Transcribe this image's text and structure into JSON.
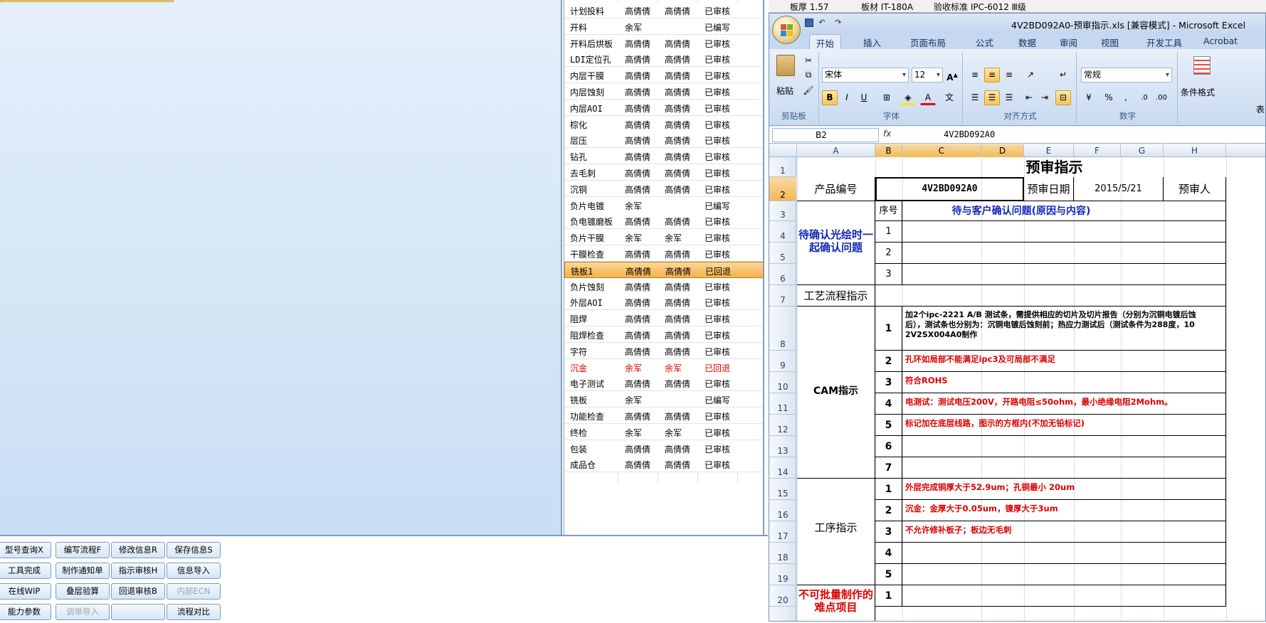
{
  "process_list": {
    "rows": [
      {
        "step": "计划投料",
        "c2": "高倩倩",
        "c3": "高倩倩",
        "status": "已审核"
      },
      {
        "step": "开料",
        "c2": "余军",
        "c3": "",
        "status": "已编写"
      },
      {
        "step": "开料后烘板",
        "c2": "高倩倩",
        "c3": "高倩倩",
        "status": "已审核"
      },
      {
        "step": "LDI定位孔",
        "c2": "高倩倩",
        "c3": "高倩倩",
        "status": "已审核"
      },
      {
        "step": "内层干膜",
        "c2": "高倩倩",
        "c3": "高倩倩",
        "status": "已审核"
      },
      {
        "step": "内层蚀刻",
        "c2": "高倩倩",
        "c3": "高倩倩",
        "status": "已审核"
      },
      {
        "step": "内层AOI",
        "c2": "高倩倩",
        "c3": "高倩倩",
        "status": "已审核"
      },
      {
        "step": "棕化",
        "c2": "高倩倩",
        "c3": "高倩倩",
        "status": "已审核"
      },
      {
        "step": "层压",
        "c2": "高倩倩",
        "c3": "高倩倩",
        "status": "已审核"
      },
      {
        "step": "钻孔",
        "c2": "高倩倩",
        "c3": "高倩倩",
        "status": "已审核"
      },
      {
        "step": "去毛刺",
        "c2": "高倩倩",
        "c3": "高倩倩",
        "status": "已审核"
      },
      {
        "step": "沉铜",
        "c2": "高倩倩",
        "c3": "高倩倩",
        "status": "已审核"
      },
      {
        "step": "负片电镀",
        "c2": "余军",
        "c3": "",
        "status": "已编写"
      },
      {
        "step": "负电镀磨板",
        "c2": "高倩倩",
        "c3": "高倩倩",
        "status": "已审核"
      },
      {
        "step": "负片干膜",
        "c2": "余军",
        "c3": "余军",
        "status": "已审核"
      },
      {
        "step": "干膜检查",
        "c2": "高倩倩",
        "c3": "高倩倩",
        "status": "已审核"
      },
      {
        "step": "铣板1",
        "c2": "高倩倩",
        "c3": "高倩倩",
        "status": "已回退",
        "selected": true
      },
      {
        "step": "负片蚀刻",
        "c2": "高倩倩",
        "c3": "高倩倩",
        "status": "已审核"
      },
      {
        "step": "外层AOI",
        "c2": "高倩倩",
        "c3": "高倩倩",
        "status": "已审核"
      },
      {
        "step": "阻焊",
        "c2": "高倩倩",
        "c3": "高倩倩",
        "status": "已审核"
      },
      {
        "step": "阻焊检查",
        "c2": "高倩倩",
        "c3": "高倩倩",
        "status": "已审核"
      },
      {
        "step": "字符",
        "c2": "高倩倩",
        "c3": "高倩倩",
        "status": "已审核"
      },
      {
        "step": "沉金",
        "c2": "余军",
        "c3": "余军",
        "status": "已回退",
        "red": true
      },
      {
        "step": "电子测试",
        "c2": "高倩倩",
        "c3": "高倩倩",
        "status": "已审核"
      },
      {
        "step": "铣板",
        "c2": "余军",
        "c3": "",
        "status": "已编写"
      },
      {
        "step": "功能检查",
        "c2": "高倩倩",
        "c3": "高倩倩",
        "status": "已审核"
      },
      {
        "step": "终检",
        "c2": "余军",
        "c3": "余军",
        "status": "已审核"
      },
      {
        "step": "包装",
        "c2": "高倩倩",
        "c3": "高倩倩",
        "status": "已审核"
      },
      {
        "step": "成品仓",
        "c2": "高倩倩",
        "c3": "高倩倩",
        "status": "已审核"
      }
    ]
  },
  "buttons": [
    [
      "型号查询X",
      "编写流程F",
      "修改信息R",
      "保存信息S"
    ],
    [
      "工具完成",
      "制作通知单",
      "指示审核H",
      "信息导入"
    ],
    [
      "在线WIP",
      "叠层验算",
      "回退审核B",
      "内部ECN"
    ],
    [
      "能力参数",
      "调单导入",
      "",
      "流程对比"
    ]
  ],
  "disabled_buttons": [
    "内部ECN",
    "调单导入"
  ],
  "top_info": {
    "thickness": "板厚 1.57",
    "material": "板材 IT-180A",
    "standard": "验收标准 IPC-6012 Ⅲ级"
  },
  "excel": {
    "title": "4V2BD092A0-预审指示.xls [兼容模式] - Microsoft Excel",
    "tabs": [
      "开始",
      "插入",
      "页面布局",
      "公式",
      "数据",
      "审阅",
      "视图",
      "开发工具",
      "Acrobat"
    ],
    "active_tab": "开始",
    "ribbon": {
      "clipboard": {
        "paste": "粘贴",
        "label": "剪贴板"
      },
      "font": {
        "name": "宋体",
        "size": "12",
        "label": "字体"
      },
      "alignment": {
        "label": "对齐方式"
      },
      "number": {
        "format": "常规",
        "label": "数字"
      },
      "styles": {
        "cond_format": "条件格式",
        "extra": "表"
      }
    },
    "namebox": "B2",
    "fx": "fx",
    "formula_value": "4V2BD092A0",
    "columns": [
      "A",
      "B",
      "C",
      "D",
      "E",
      "F",
      "G",
      "H"
    ],
    "rows": [
      "1",
      "2",
      "3",
      "4",
      "5",
      "6",
      "7",
      "8",
      "9",
      "10",
      "11",
      "12",
      "13",
      "14",
      "15",
      "16",
      "17",
      "18",
      "19",
      "20"
    ],
    "sheet": {
      "title": "预审指示",
      "product_label": "产品编号",
      "product_value": "4V2BD092A0",
      "date_label": "预审日期",
      "date_value": "2015/5/21",
      "reviewer_label": "预审人",
      "seq_label": "序号",
      "pending_header": "待与客户确认问题(原因与内容)",
      "pending_label": "待确认光绘时一起确认问题",
      "flow_label": "工艺流程指示",
      "cam_label": "CAM指示",
      "process_label": "工序指示",
      "no_batch_label": "不可批量制作的难点项目",
      "cam_items": [
        {
          "n": "1",
          "text": "加2个ipc-2221 A/B 测试条，需提供相应的切片及切片报告（分别为沉铜电镀后蚀",
          "text2": "后），测试条也分别为：沉铜电镀后蚀刻前；热应力测试后（测试条件为288度，10",
          "text3": "2V2SX004A0制作"
        },
        {
          "n": "2",
          "text": "孔环如局部不能满足ipc3及可局部不满足"
        },
        {
          "n": "3",
          "text": "符合ROHS"
        },
        {
          "n": "4",
          "text": "电测试：测试电压200V，开路电阻≤50ohm，最小绝缘电阻2Mohm。"
        },
        {
          "n": "5",
          "text": "标记加在底层线路，图示的方框内(不加无铅标记)"
        },
        {
          "n": "6",
          "text": ""
        },
        {
          "n": "7",
          "text": ""
        }
      ],
      "process_items": [
        {
          "n": "1",
          "text": "外层完成铜厚大于52.9um；孔铜最小 20um"
        },
        {
          "n": "2",
          "text": "沉金：金厚大于0.05um，镍厚大于3um"
        },
        {
          "n": "3",
          "text": "不允许修补板子；板边无毛刺"
        },
        {
          "n": "4",
          "text": ""
        },
        {
          "n": "5",
          "text": ""
        }
      ],
      "pending_nums": [
        "1",
        "2",
        "3"
      ],
      "no_batch_nums": [
        "1"
      ]
    }
  }
}
